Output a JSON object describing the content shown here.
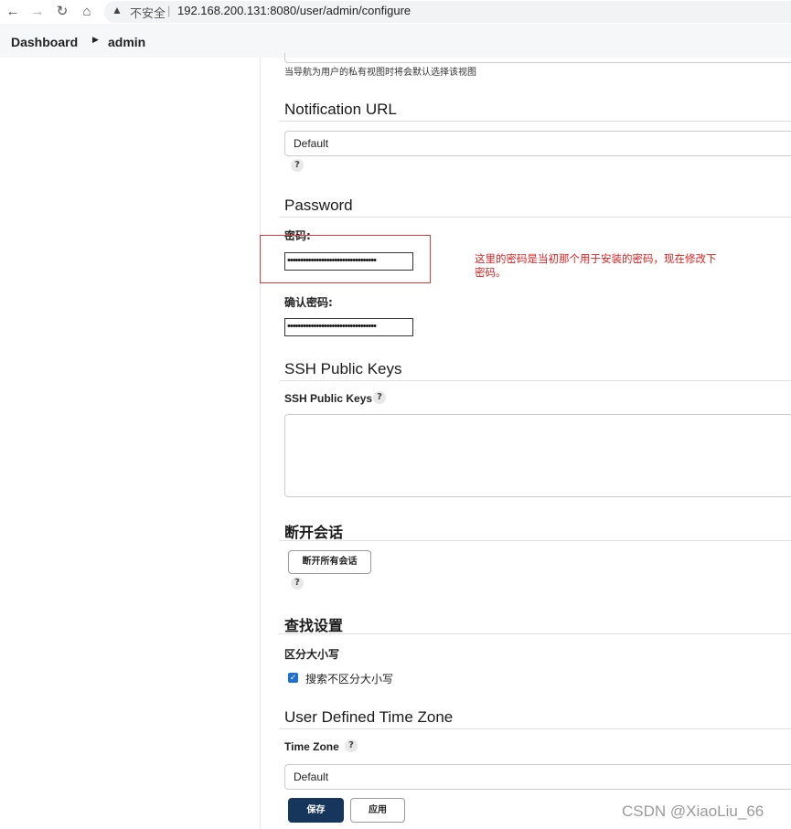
{
  "browser": {
    "insecure_label": "不安全",
    "separator": "|",
    "url": "192.168.200.131:8080/user/admin/configure"
  },
  "breadcrumb": {
    "items": [
      "Dashboard",
      "admin"
    ]
  },
  "view_section": {
    "hint": "当导航为用户的私有视图时将会默认选择该视图"
  },
  "notification": {
    "heading": "Notification URL",
    "select_value": "Default",
    "help": "?"
  },
  "password": {
    "heading": "Password",
    "password_label": "密码:",
    "password_value": "••••••••••••••••••••••••••••••••••",
    "confirm_label": "确认密码:",
    "confirm_value": "••••••••••••••••••••••••••••••••••",
    "annotation": "这里的密码是当初那个用于安装的密码，现在修改下密码。"
  },
  "ssh": {
    "heading": "SSH Public Keys",
    "label": "SSH Public Keys",
    "help": "?"
  },
  "sessions": {
    "heading": "断开会话",
    "button": "断开所有会话",
    "help": "?"
  },
  "search": {
    "heading": "查找设置",
    "label": "区分大小写",
    "checkbox_label": "搜索不区分大小写",
    "checkbox_checked": true
  },
  "timezone": {
    "heading": "User Defined Time Zone",
    "label": "Time Zone",
    "help": "?",
    "select_value": "Default"
  },
  "actions": {
    "save": "保存",
    "apply": "应用"
  },
  "watermark": "CSDN @XiaoLiu_66",
  "colors": {
    "save_button": "#17365b",
    "annotation": "#e02020",
    "checkbox": "#1f6fd1"
  }
}
